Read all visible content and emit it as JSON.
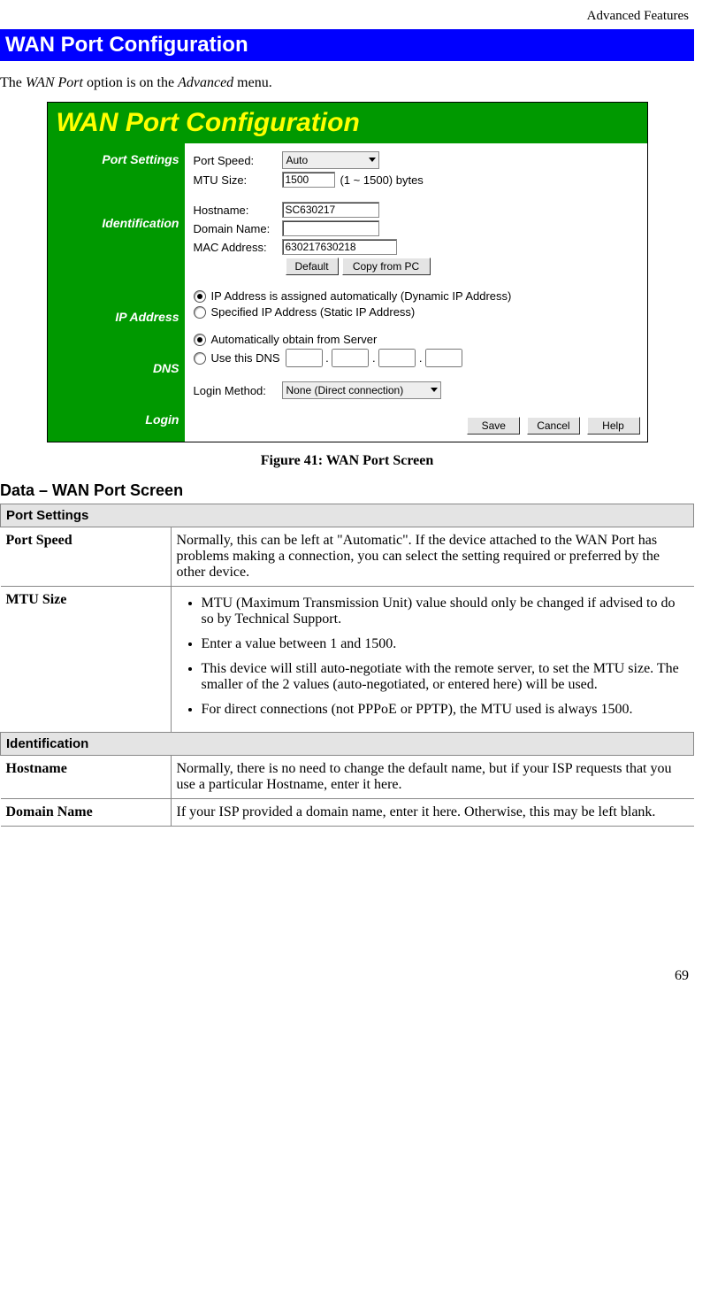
{
  "doc": {
    "section_header": "Advanced Features",
    "title": "WAN Port Configuration",
    "intro_prefix": "The ",
    "intro_em1": "WAN Port",
    "intro_mid": " option is on the ",
    "intro_em2": "Advanced",
    "intro_suffix": " menu.",
    "figure_caption": "Figure 41: WAN Port Screen",
    "data_heading": "Data – WAN Port Screen",
    "page_number": "69"
  },
  "screen": {
    "title": "WAN Port Configuration",
    "sidebar": {
      "port_settings": "Port Settings",
      "identification": "Identification",
      "ip_address": "IP Address",
      "dns": "DNS",
      "login": "Login"
    },
    "port": {
      "speed_label": "Port Speed:",
      "speed_value": "Auto",
      "mtu_label": "MTU Size:",
      "mtu_value": "1500",
      "mtu_hint": "(1 ~ 1500) bytes"
    },
    "ident": {
      "hostname_label": "Hostname:",
      "hostname_value": "SC630217",
      "domain_label": "Domain Name:",
      "domain_value": "",
      "mac_label": "MAC Address:",
      "mac_value": "630217630218",
      "btn_default": "Default",
      "btn_copy": "Copy from PC"
    },
    "ip": {
      "opt_auto": "IP Address is assigned automatically (Dynamic IP Address)",
      "opt_static": "Specified IP Address (Static IP Address)"
    },
    "dns": {
      "opt_auto": "Automatically obtain from Server",
      "opt_manual": "Use this DNS"
    },
    "login": {
      "label": "Login Method:",
      "value": "None (Direct connection)"
    },
    "buttons": {
      "save": "Save",
      "cancel": "Cancel",
      "help": "Help"
    }
  },
  "table": {
    "section_port_settings": "Port Settings",
    "port_speed_key": "Port Speed",
    "port_speed_val": "Normally, this can be left at \"Automatic\". If the device attached to the WAN Port has problems making a connection, you can select the setting required or preferred by the other device.",
    "mtu_key": "MTU Size",
    "mtu_b1": "MTU (Maximum Transmission Unit) value should only be changed if advised to do so by Technical Support.",
    "mtu_b2": "Enter a value between 1 and 1500.",
    "mtu_b3": "This device will still auto-negotiate with the remote server, to set the MTU size. The smaller of the 2 values (auto-negotiated, or entered here) will be used.",
    "mtu_b4": "For direct connections (not PPPoE or PPTP), the MTU used is always 1500.",
    "section_identification": "Identification",
    "hostname_key": "Hostname",
    "hostname_val": "Normally, there is no need to change the default name, but if your ISP requests that you use a particular Hostname, enter it here.",
    "domain_key": "Domain Name",
    "domain_val": "If your ISP provided a domain name, enter it here. Otherwise, this may be left blank."
  }
}
